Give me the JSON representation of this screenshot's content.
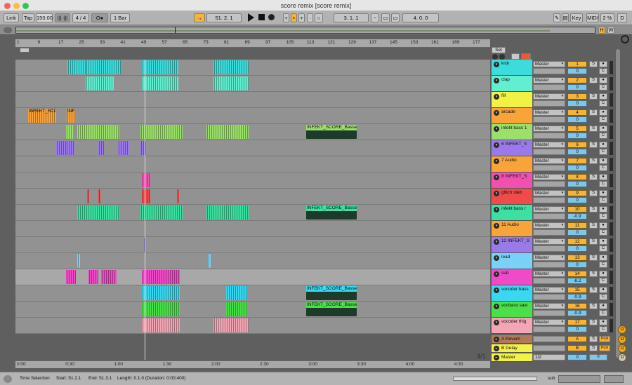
{
  "window": {
    "title": "score remix  [score remix]"
  },
  "transport": {
    "link": "Link",
    "tap": "Tap",
    "tempo": "150.00",
    "signature": "4 / 4",
    "metronome": "1 Bar",
    "position": "51.  2.  1",
    "loop_start": "3.  1.  1",
    "loop_length": "4.  0.  0",
    "key": "Key",
    "midi": "MIDI",
    "cpu": "2 %",
    "d": "D"
  },
  "overview": {
    "h": "H",
    "w": "W"
  },
  "ruler_labels": [
    "1",
    "9",
    "17",
    "25",
    "33",
    "41",
    "49",
    "57",
    "65",
    "73",
    "81",
    "89",
    "97",
    "105",
    "113",
    "121",
    "129",
    "137",
    "145",
    "153",
    "161",
    "169",
    "177"
  ],
  "set_label": "Set",
  "tracks": [
    {
      "name": "kick",
      "color": "#3ddcdc",
      "input": "Master",
      "num": "1",
      "vol": "0",
      "s": "S",
      "c": "C"
    },
    {
      "name": "clap",
      "color": "#62eed0",
      "input": "Master",
      "num": "2",
      "vol": "0",
      "s": "S",
      "c": "C"
    },
    {
      "name": "fill",
      "color": "#f2f244",
      "input": "Master",
      "num": "3",
      "vol": "0",
      "s": "S",
      "c": "C"
    },
    {
      "name": "arcade",
      "color": "#f8a43a",
      "input": "Master",
      "num": "4",
      "vol": "0",
      "s": "S",
      "c": "C"
    },
    {
      "name": "infekt bass 1",
      "color": "#9be06a",
      "input": "Master",
      "num": "5",
      "vol": "0",
      "s": "S",
      "c": "C"
    },
    {
      "name": "6 INFEKT_S",
      "color": "#9a7ae8",
      "input": "Master",
      "num": "6",
      "vol": "0",
      "s": "S",
      "c": "C"
    },
    {
      "name": "7 Audio",
      "color": "#f8a43a",
      "input": "Master",
      "num": "7",
      "vol": "0",
      "s": "S",
      "c": "C"
    },
    {
      "name": "8 INFEKT_S",
      "color": "#f050b0",
      "input": "Master",
      "num": "8",
      "vol": "0",
      "s": "S",
      "c": "C"
    },
    {
      "name": "glitch stab",
      "color": "#f04a4a",
      "input": "Master",
      "num": "9",
      "vol": "0",
      "s": "S",
      "c": "C"
    },
    {
      "name": "infekt bass r",
      "color": "#3ce0a0",
      "input": "Master",
      "num": "10",
      "vol": "-0.9",
      "s": "S",
      "c": "C"
    },
    {
      "name": "11 Audio",
      "color": "#f8a43a",
      "input": "Master",
      "num": "11",
      "vol": "0",
      "s": "S",
      "c": "C"
    },
    {
      "name": "12 INFEKT_S",
      "color": "#9a7ae8",
      "input": "Master",
      "num": "12",
      "vol": "0",
      "s": "S",
      "c": "C"
    },
    {
      "name": "lead",
      "color": "#7ad0f6",
      "input": "Master",
      "num": "13",
      "vol": "0",
      "s": "S",
      "c": "C"
    },
    {
      "name": "sub",
      "color": "#f04ac8",
      "input": "Master",
      "num": "14",
      "vol": "-8.2",
      "s": "S",
      "c": "C"
    },
    {
      "name": "vocoder bass",
      "color": "#3ad8f0",
      "input": "Master",
      "num": "15",
      "vol": "-0.9",
      "s": "S",
      "c": "C"
    },
    {
      "name": "vocbass saw",
      "color": "#4ae04a",
      "input": "Master",
      "num": "16",
      "vol": "-0.9",
      "s": "S",
      "c": "C"
    },
    {
      "name": "vocoder thig",
      "color": "#f2a6b4",
      "input": "Master",
      "num": "17",
      "vol": "0",
      "s": "S",
      "c": "C"
    }
  ],
  "returns": [
    {
      "name": "A Reverb",
      "color": "#b07a5a",
      "letter": "A",
      "s": "S",
      "post": "Post"
    },
    {
      "name": "B Delay",
      "color": "#f2f244",
      "letter": "B",
      "s": "S",
      "post": "Post"
    }
  ],
  "master": {
    "name": "Master",
    "color": "#f2f244",
    "input": "1/2",
    "vol": "0",
    "s": "0"
  },
  "clip_labels": {
    "arcade_1": "INFEKT_SCO",
    "arcade_2": "INF",
    "bass1": "INFEKT_SCORE_Basses",
    "bassr": "INFEKT_SCORE_Basses",
    "vocbass": "INFEKT_SCORE_Basses",
    "vocsaw": "INFEKT_SCORE_Basses"
  },
  "time_labels": [
    "0:00",
    "0:30",
    "1:00",
    "1:30",
    "2:00",
    "2:30",
    "3:00",
    "3:30",
    "4:00",
    "4:30"
  ],
  "arrangement_position": "4/1",
  "statusbar": {
    "mode": "Time Selection",
    "start": "Start: 51.2.1",
    "end": "End: 51.3.1",
    "length": "Length: 0.1.0  (Duration: 0:00:400)",
    "sub": "sub"
  },
  "side_buttons": [
    "O",
    "O",
    "O",
    "O"
  ]
}
